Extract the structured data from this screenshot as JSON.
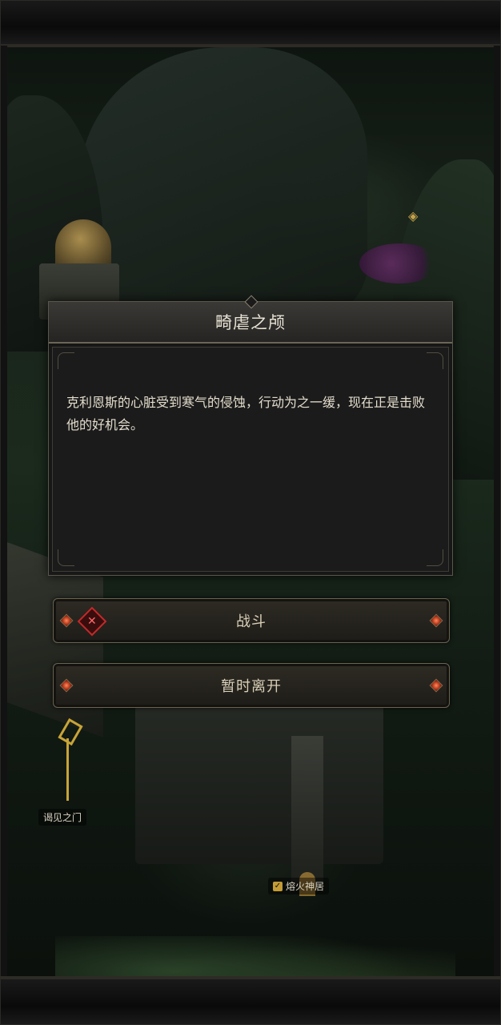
{
  "dialog": {
    "title": "畸虐之颅",
    "text": "克利恩斯的心脏受到寒气的侵蚀，行动为之一缓，现在正是击败他的好机会。"
  },
  "choices": {
    "fight_label": "战斗",
    "leave_label": "暂时离开"
  },
  "map": {
    "labels": {
      "gate": "谒见之门",
      "shrine": "熔火神居"
    }
  },
  "colors": {
    "accent_gold": "#c7a438",
    "danger_red": "#c22a2a",
    "dialog_bg": "#1b1b1b"
  }
}
